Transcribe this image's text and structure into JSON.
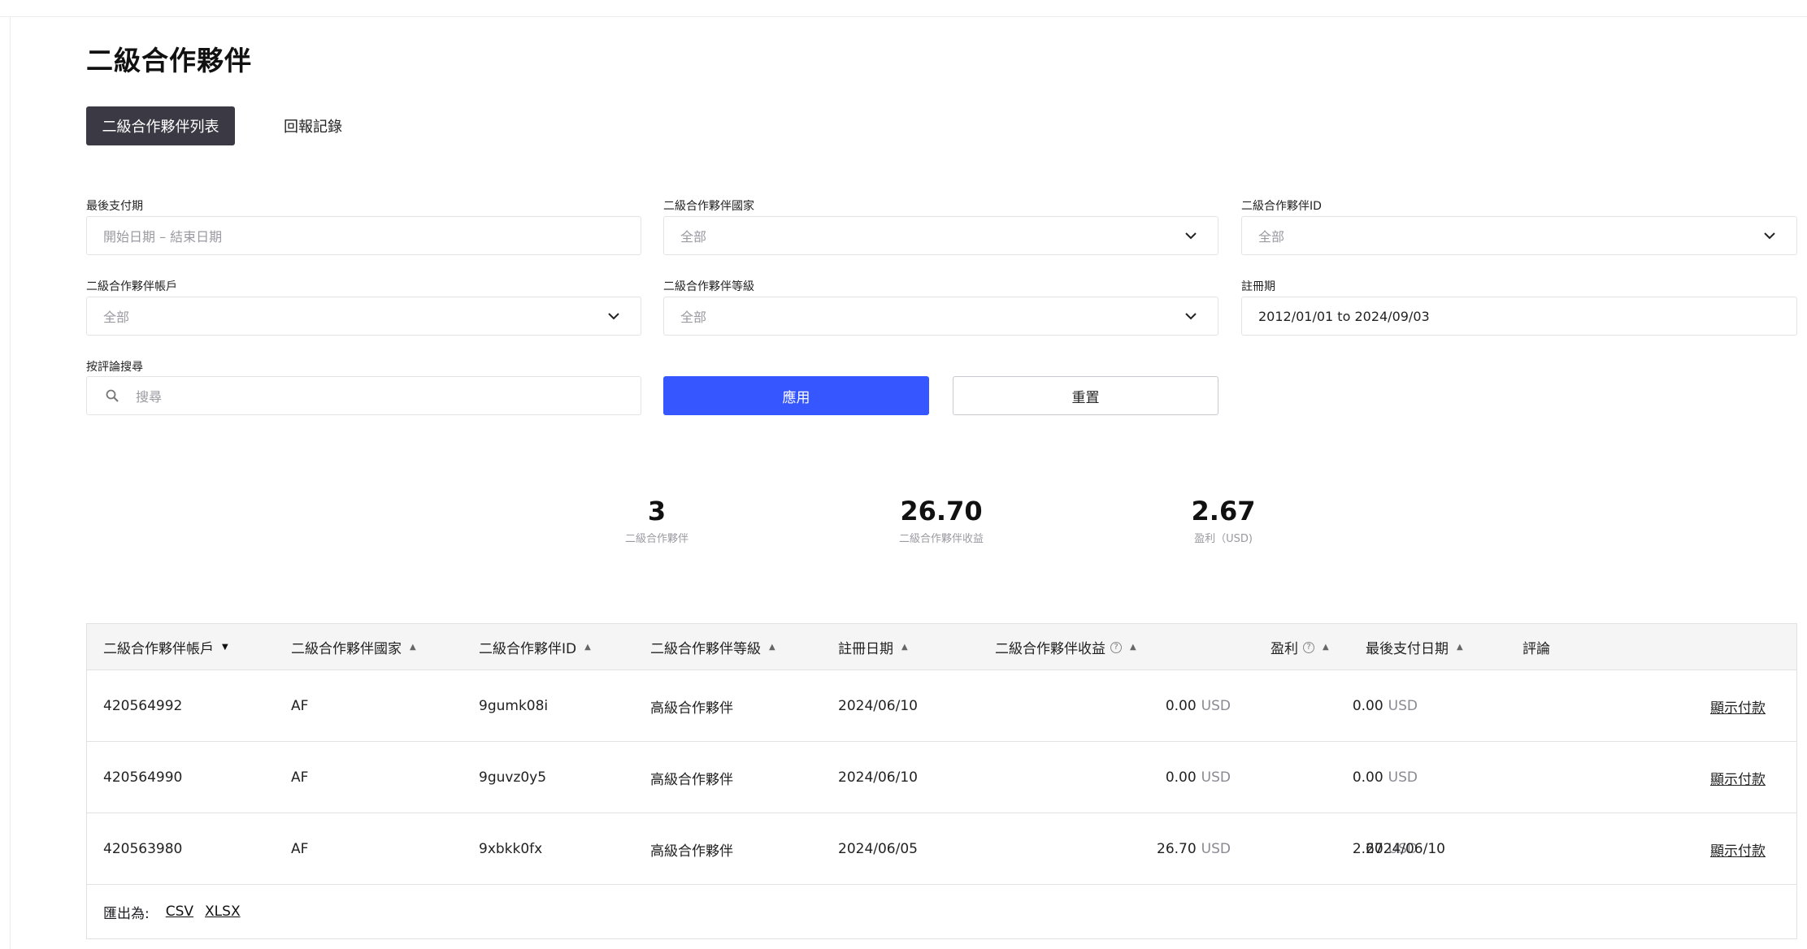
{
  "page": {
    "title": "二級合作夥伴"
  },
  "tabs": [
    {
      "label": "二級合作夥伴列表",
      "active": true
    },
    {
      "label": "回報記錄",
      "active": false
    }
  ],
  "filters": {
    "last_payment": {
      "label": "最後支付期",
      "placeholder": "開始日期 – 結束日期"
    },
    "country": {
      "label": "二級合作夥伴國家",
      "value": "全部"
    },
    "partner_id": {
      "label": "二級合作夥伴ID",
      "value": "全部"
    },
    "account": {
      "label": "二級合作夥伴帳戶",
      "value": "全部"
    },
    "level": {
      "label": "二級合作夥伴等級",
      "value": "全部"
    },
    "registration": {
      "label": "註冊期",
      "value": "2012/01/01 to 2024/09/03"
    },
    "comment_search": {
      "label": "按評論搜尋",
      "placeholder": "搜尋"
    }
  },
  "buttons": {
    "apply": "應用",
    "reset": "重置"
  },
  "stats": [
    {
      "value": "3",
      "caption": "二級合作夥伴"
    },
    {
      "value": "26.70",
      "caption": "二級合作夥伴收益"
    },
    {
      "value": "2.67",
      "caption": "盈利（USD)"
    }
  ],
  "table": {
    "headers": {
      "account": "二級合作夥伴帳戶",
      "country": "二級合作夥伴國家",
      "id": "二級合作夥伴ID",
      "level": "二級合作夥伴等級",
      "reg_date": "註冊日期",
      "revenue": "二級合作夥伴收益",
      "profit": "盈利",
      "last_payment": "最後支付日期",
      "comment": "評論"
    },
    "rows": [
      {
        "account": "420564992",
        "country": "AF",
        "id": "9gumk08i",
        "level": "高級合作夥伴",
        "reg_date": "2024/06/10",
        "revenue": "0.00",
        "revenue_unit": "USD",
        "profit": "0.00",
        "profit_unit": "USD",
        "last_payment": "",
        "action": "顯示付款"
      },
      {
        "account": "420564990",
        "country": "AF",
        "id": "9guvz0y5",
        "level": "高級合作夥伴",
        "reg_date": "2024/06/10",
        "revenue": "0.00",
        "revenue_unit": "USD",
        "profit": "0.00",
        "profit_unit": "USD",
        "last_payment": "",
        "action": "顯示付款"
      },
      {
        "account": "420563980",
        "country": "AF",
        "id": "9xbkk0fx",
        "level": "高級合作夥伴",
        "reg_date": "2024/06/05",
        "revenue": "26.70",
        "revenue_unit": "USD",
        "profit": "2.67",
        "profit_unit": "USD",
        "last_payment": "2024/06/10",
        "action": "顯示付款"
      }
    ]
  },
  "export": {
    "label": "匯出為:",
    "csv": "CSV",
    "xlsx": "XLSX"
  }
}
